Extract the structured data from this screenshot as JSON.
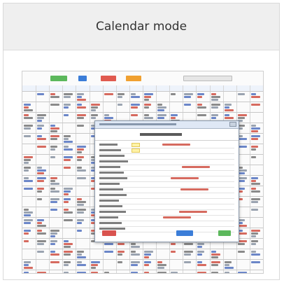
{
  "header": {
    "title": "Calendar mode"
  },
  "colors": {
    "header_bg": "#efefef",
    "toolbar_green": "#5cb85c",
    "toolbar_blue": "#3b7dd8",
    "toolbar_red": "#e05a4f",
    "toolbar_orange": "#f0a030",
    "modal_ok": "#5cb85c",
    "modal_save": "#3b7dd8",
    "modal_delete": "#d9534f"
  },
  "screenshot": {
    "icon_name": "calendar-screenshot-thumbnail"
  }
}
